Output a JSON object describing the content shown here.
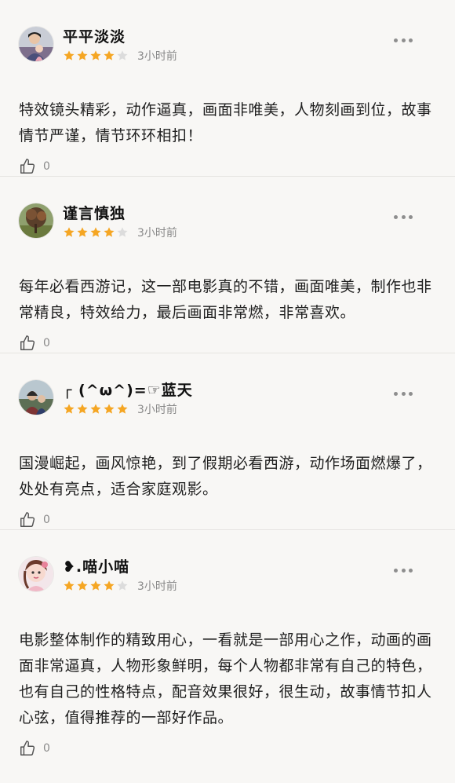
{
  "colors": {
    "star_filled": "#f5a623",
    "star_empty": "#dcdcdc",
    "background": "#f8f7f5"
  },
  "reviews": [
    {
      "username": "平平淡淡",
      "rating": 4,
      "time": "3小时前",
      "content": "特效镜头精彩，动作逼真，画面非唯美，人物刻画到位，故事情节严谨，情节环环相扣！",
      "likes": "0"
    },
    {
      "username": "谨言慎独",
      "rating": 4,
      "time": "3小时前",
      "content": "每年必看西游记，这一部电影真的不错，画面唯美，制作也非常精良，特效给力，最后画面非常燃，非常喜欢。",
      "likes": "0"
    },
    {
      "username": "┌ (^ω^)=☞蓝天",
      "rating": 5,
      "time": "3小时前",
      "content": "国漫崛起，画风惊艳，到了假期必看西游，动作场面燃爆了，处处有亮点，适合家庭观影。",
      "likes": "0"
    },
    {
      "username": "❥.喵小喵",
      "rating": 4,
      "time": "3小时前",
      "content": "电影整体制作的精致用心，一看就是一部用心之作，动画的画面非常逼真，人物形象鲜明，每个人物都非常有自己的特色，也有自己的性格特点，配音效果很好，很生动，故事情节扣人心弦，值得推荐的一部好作品。",
      "likes": "0"
    }
  ]
}
